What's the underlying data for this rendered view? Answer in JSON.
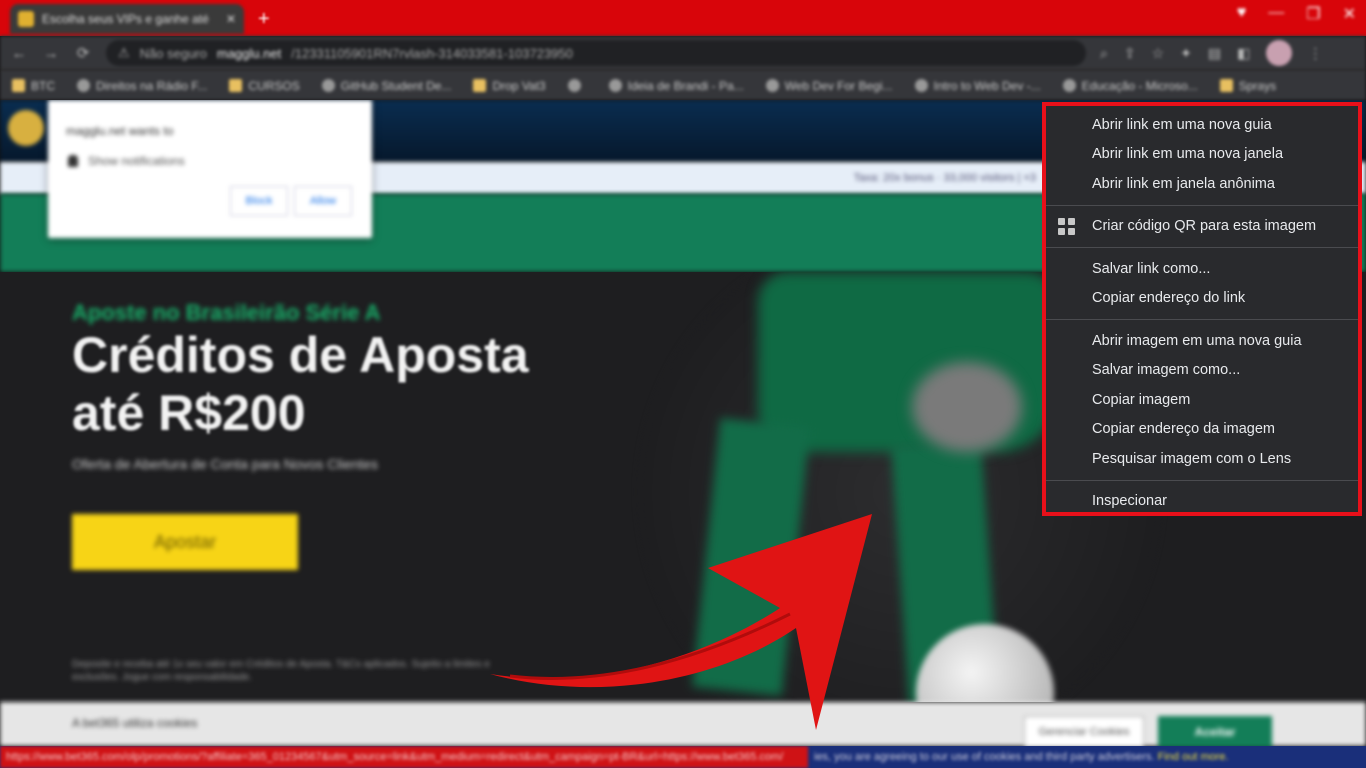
{
  "browser": {
    "tab_title": "Escolha seus VIPs e ganhe até",
    "new_tab": "+",
    "window_controls": [
      "♥",
      "—",
      "❐",
      "✕"
    ],
    "nav": [
      "←",
      "→",
      "⟳"
    ],
    "address": {
      "security": "Não seguro",
      "host": "magglu.net",
      "path": "/12331105901RN7rvlash-314033581-103723950"
    },
    "toolbar_icons": [
      "⌕",
      "⇪",
      "☆",
      "✦",
      "▤",
      "◧"
    ],
    "bookmarks": [
      "BTC",
      "Direitos na Rádio F...",
      "CURSOS",
      "GitHub Student De...",
      "Drop Vat3",
      "",
      "Ideia de Brandi - Pa...",
      "Web Dev For Begi...",
      "Intro to Web Dev -...",
      "Educação - Microso...",
      "Sprays"
    ]
  },
  "page": {
    "notification": {
      "title": "magglu.net wants to",
      "permission": "Show notifications",
      "block": "Block",
      "allow": "Allow"
    },
    "top_info": "Taxa: 20x bonus · 33,000 visitors | ×3",
    "hero": {
      "kicker": "Aposte no Brasileirão Série A",
      "title_line1": "Créditos de Aposta",
      "title_line2": "até R$200",
      "subtitle": "Oferta de Abertura de Conta para Novos Clientes",
      "button": "Apostar",
      "fine_print": "Deposite e receba até 1x seu valor em Créditos de Aposta. T&Cs aplicados. Sujeito a limites e exclusões. Jogue com responsabilidade."
    },
    "cookie": {
      "text": "A bet365 utiliza cookies",
      "manage": "Gerenciar Cookies",
      "accept": "Aceitar"
    }
  },
  "context_menu": {
    "groups": [
      [
        "Abrir link em uma nova guia",
        "Abrir link em uma nova janela",
        "Abrir link em janela anônima"
      ],
      [
        "Criar código QR para esta imagem"
      ],
      [
        "Salvar link como...",
        "Copiar endereço do link"
      ],
      [
        "Abrir imagem em uma nova guia",
        "Salvar imagem como...",
        "Copiar imagem",
        "Copiar endereço da imagem",
        "Pesquisar imagem com o Lens"
      ],
      [
        "Inspecionar"
      ]
    ]
  },
  "status": {
    "url": "https://www.bet365.com/olp/promotions/?affiliate=365_01234567&utm_source=link&utm_medium=redirect&utm_campaign=pt-BR&url=https://www.bet365.com/",
    "notice": "ies, you are agreeing to our use of cookies and third party advertisers.",
    "find_more": "Find out more."
  },
  "colors": {
    "highlight": "#e8101a",
    "menu_bg": "#292a2d",
    "brand_green": "#137e58",
    "bet_yellow": "#f7d416"
  }
}
